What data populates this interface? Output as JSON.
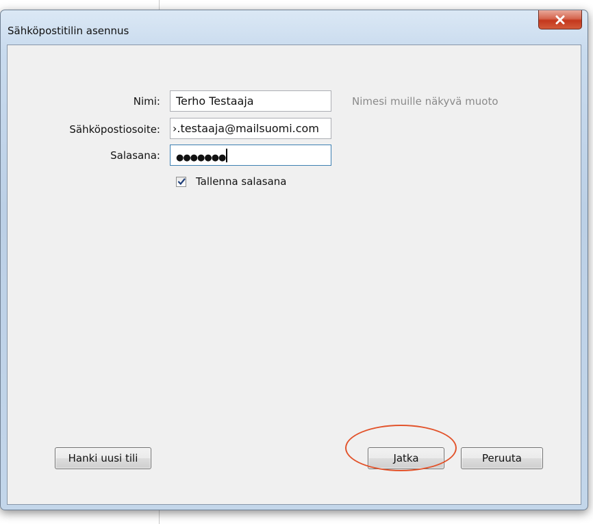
{
  "window": {
    "title": "Sähköpostitilin asennus"
  },
  "form": {
    "name_label": "Nimi:",
    "name_value": "Terho Testaaja",
    "name_hint": "Nimesi muille näkyvä muoto",
    "email_label": "Sähköpostiosoite:",
    "email_value": "›.testaaja@mailsuomi.com",
    "password_label": "Salasana:",
    "password_value": "●●●●●●●",
    "remember_label": "Tallenna salasana",
    "remember_checked": true
  },
  "buttons": {
    "new_account": "Hanki uusi tili",
    "continue": "Jatka",
    "cancel": "Peruuta"
  },
  "icons": {
    "close": "close-icon",
    "check": "checkmark-icon"
  },
  "colors": {
    "highlight": "#e2532b",
    "close_button": "#c4381d"
  }
}
